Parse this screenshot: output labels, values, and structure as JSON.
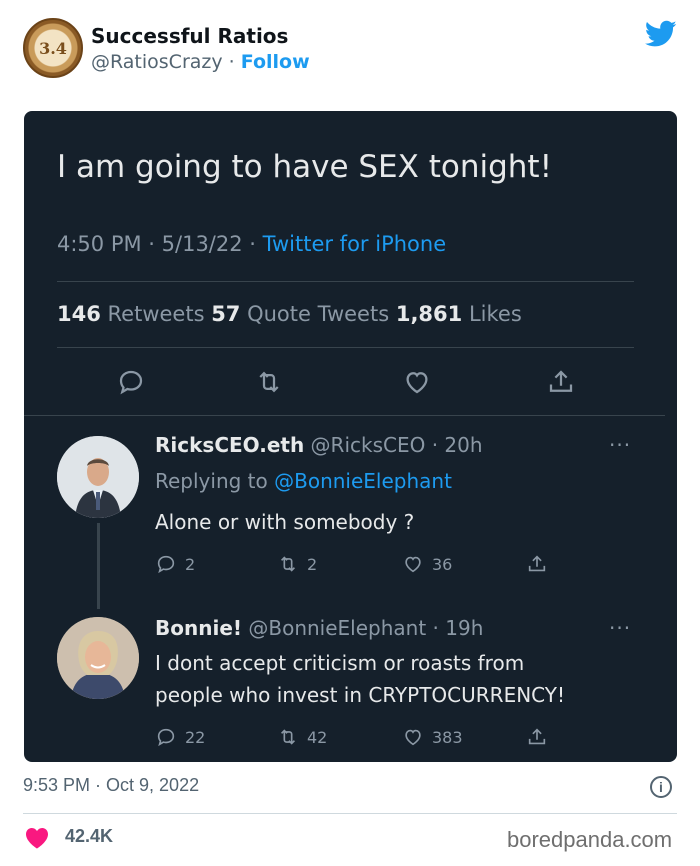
{
  "embed": {
    "account": {
      "avatar_text": "3.4",
      "name": "Successful Ratios",
      "handle": "@RatiosCrazy",
      "separator": " · ",
      "follow_label": "Follow"
    },
    "brand_icon": "twitter-bird-icon",
    "timestamp": "9:53 PM · Oct 9, 2022",
    "info_icon": "i",
    "likes": "42.4K",
    "watermark": "boredpanda.com",
    "colors": {
      "accent": "#1d9bf0",
      "heart": "#f91880",
      "card_bg": "#15202b"
    }
  },
  "screenshot": {
    "main_tweet": {
      "text": "I am going to have SEX tonight!",
      "time_date": "4:50 PM · 5/13/22 · ",
      "source": "Twitter for iPhone",
      "retweets_count": "146",
      "retweets_label": " Retweets  ",
      "quotes_count": "57",
      "quotes_label": " Quote Tweets  ",
      "likes_count": "1,861",
      "likes_label": " Likes"
    },
    "reply1": {
      "name": "RicksCEO.eth",
      "handle_time": " @RicksCEO · 20h",
      "replying_prefix": "Replying to ",
      "replying_handle": "@BonnieElephant",
      "text": "Alone or with somebody ?",
      "replies": "2",
      "retweets": "2",
      "likes": "36",
      "more": "···"
    },
    "reply2": {
      "name": "Bonnie!",
      "handle_time": " @BonnieElephant · 19h",
      "line1": "I dont accept criticism or roasts from",
      "line2": "people who invest in CRYPTOCURRENCY!",
      "replies": "22",
      "retweets": "42",
      "likes": "383",
      "more": "···"
    }
  }
}
